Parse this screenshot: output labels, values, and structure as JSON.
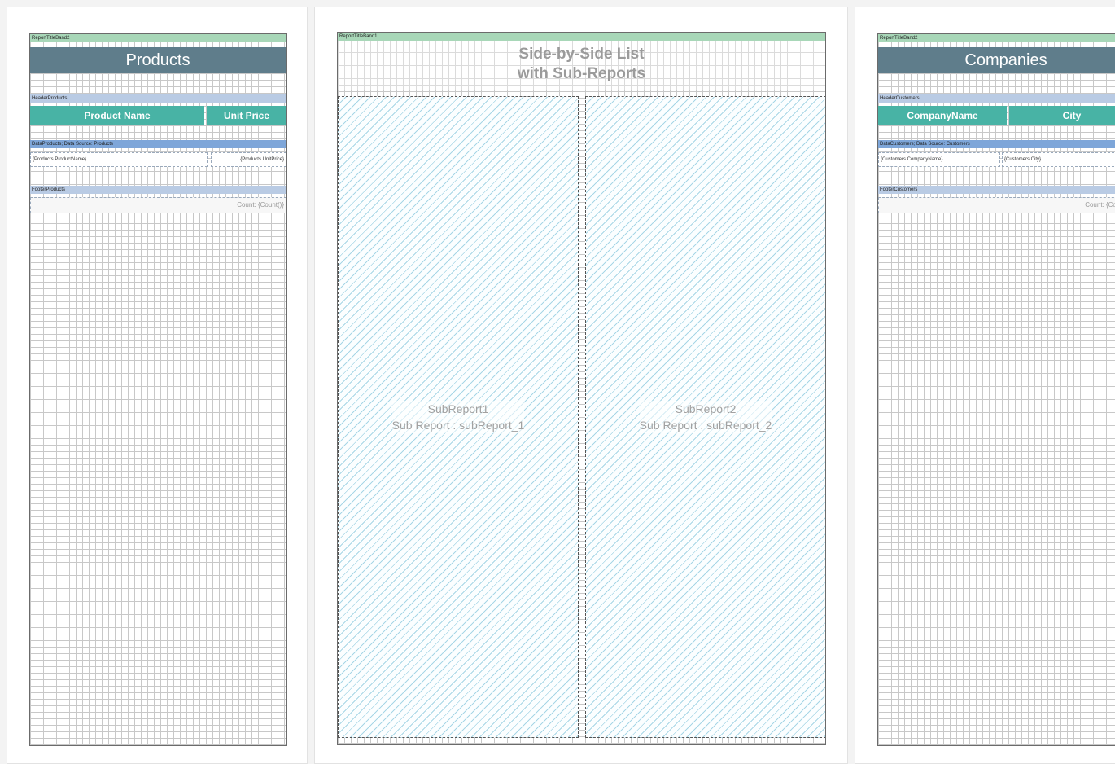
{
  "left_report": {
    "title_band_label": "ReportTitleBand2",
    "title": "Products",
    "header_band_label": "HeaderProducts",
    "columns": [
      "Product Name",
      "Unit Price"
    ],
    "data_band_label": "DataProducts; Data Source: Products",
    "data_fields": [
      "{Products.ProductName}",
      "{Products.UnitPrice}"
    ],
    "footer_band_label": "FooterProducts",
    "footer_text": "Count: {Count()}"
  },
  "main_report": {
    "title_band_label": "ReportTitleBand1",
    "title_line1": "Side-by-Side List",
    "title_line2": "with Sub-Reports",
    "subreports": [
      {
        "name": "SubReport1",
        "desc": "Sub Report : subReport_1"
      },
      {
        "name": "SubReport2",
        "desc": "Sub Report : subReport_2"
      }
    ]
  },
  "right_report": {
    "title_band_label": "ReportTitleBand2",
    "title": "Companies",
    "header_band_label": "HeaderCustomers",
    "columns": [
      "CompanyName",
      "City"
    ],
    "data_band_label": "DataCustomers; Data Source: Customers",
    "data_fields": [
      "{Customers.CompanyName}",
      "{Customers.City}"
    ],
    "footer_band_label": "FooterCustomers",
    "footer_text": "Count: {Count()}"
  }
}
